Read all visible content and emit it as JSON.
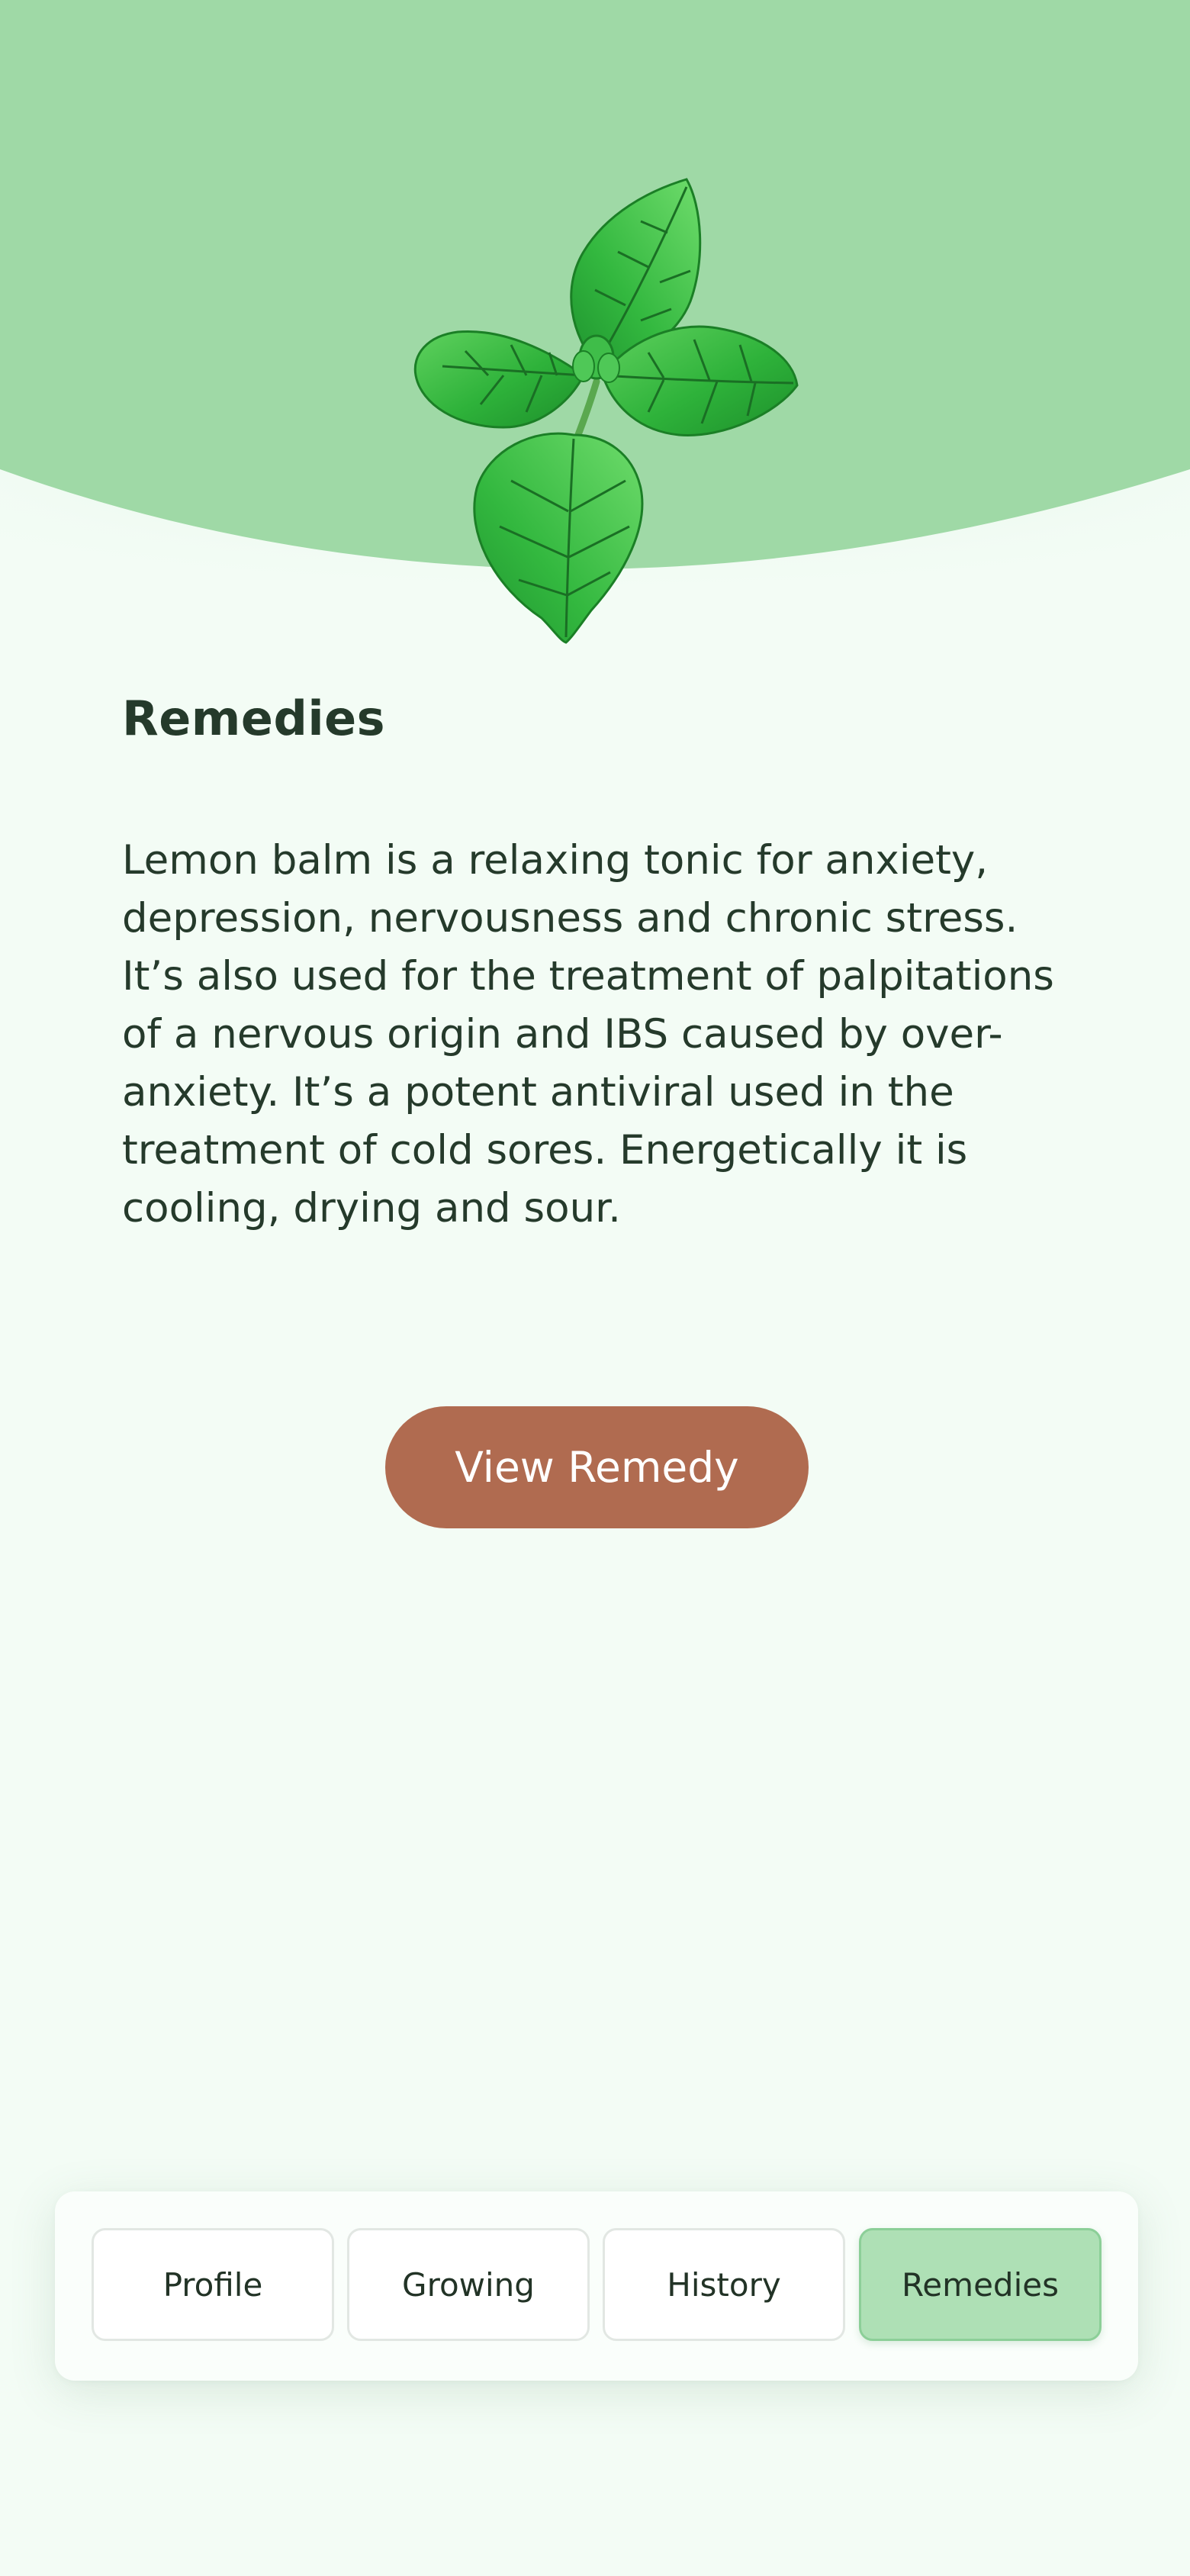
{
  "content": {
    "title": "Remedies",
    "description": "Lemon balm is a relaxing tonic for anxiety, depression, nervousness and chronic stress. It’s also used for the treatment of palpitations of a nervous origin and IBS caused by over-anxiety. It’s a potent antiviral used in the treatment of cold sores. Energetically it is cooling, drying and sour.",
    "button_label": "View Remedy"
  },
  "nav": {
    "tabs": [
      {
        "label": "Profile",
        "active": false
      },
      {
        "label": "Growing",
        "active": false
      },
      {
        "label": "History",
        "active": false
      },
      {
        "label": "Remedies",
        "active": true
      }
    ]
  },
  "colors": {
    "background": "#f3fcf5",
    "header_green": "#9fd9a6",
    "button": "#b06b50",
    "active_tab": "#aee0b5",
    "text": "#253a2b"
  },
  "icons": {
    "hero": "lemon-balm-plant-illustration"
  }
}
